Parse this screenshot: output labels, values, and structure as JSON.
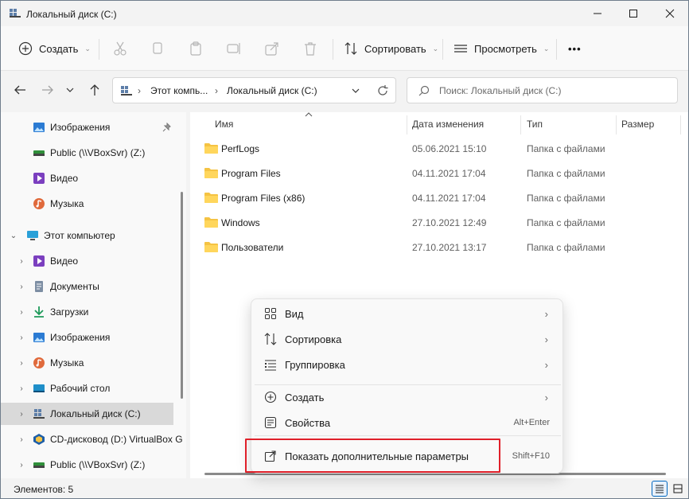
{
  "window": {
    "title": "Локальный диск (C:)"
  },
  "toolbar": {
    "create_label": "Создать",
    "sort_label": "Сортировать",
    "view_label": "Просмотреть",
    "more_label": "•••"
  },
  "address": {
    "segment1": "Этот компь...",
    "segment2": "Локальный диск (C:)",
    "separator": "›"
  },
  "search": {
    "placeholder": "Поиск: Локальный диск (C:)"
  },
  "nav": {
    "quick": [
      {
        "label": "Изображения"
      },
      {
        "label": "Public (\\\\VBoxSvr) (Z:)"
      },
      {
        "label": "Видео"
      },
      {
        "label": "Музыка"
      }
    ],
    "this_pc": "Этот компьютер",
    "pc_items": [
      {
        "label": "Видео"
      },
      {
        "label": "Документы"
      },
      {
        "label": "Загрузки"
      },
      {
        "label": "Изображения"
      },
      {
        "label": "Музыка"
      },
      {
        "label": "Рабочий стол"
      },
      {
        "label": "Локальный диск (C:)"
      },
      {
        "label": "CD-дисковод (D:) VirtualBox G"
      },
      {
        "label": "Public (\\\\VBoxSvr) (Z:)"
      }
    ]
  },
  "columns": {
    "name": "Имя",
    "date": "Дата изменения",
    "type": "Тип",
    "size": "Размер"
  },
  "files": [
    {
      "name": "PerfLogs",
      "date": "05.06.2021 15:10",
      "type": "Папка с файлами"
    },
    {
      "name": "Program Files",
      "date": "04.11.2021 17:04",
      "type": "Папка с файлами"
    },
    {
      "name": "Program Files (x86)",
      "date": "04.11.2021 17:04",
      "type": "Папка с файлами"
    },
    {
      "name": "Windows",
      "date": "27.10.2021 12:49",
      "type": "Папка с файлами"
    },
    {
      "name": "Пользователи",
      "date": "27.10.2021 13:17",
      "type": "Папка с файлами"
    }
  ],
  "context_menu": {
    "view": "Вид",
    "sort": "Сортировка",
    "group": "Группировка",
    "create": "Создать",
    "properties": "Свойства",
    "properties_shortcut": "Alt+Enter",
    "more_options": "Показать дополнительные параметры",
    "more_options_shortcut": "Shift+F10",
    "submenu_arrow": "›"
  },
  "status": {
    "items_count": "Элементов: 5"
  },
  "colors": {
    "accent": "#0067c0",
    "highlight": "#e0202a",
    "folder": "#f5c343"
  }
}
